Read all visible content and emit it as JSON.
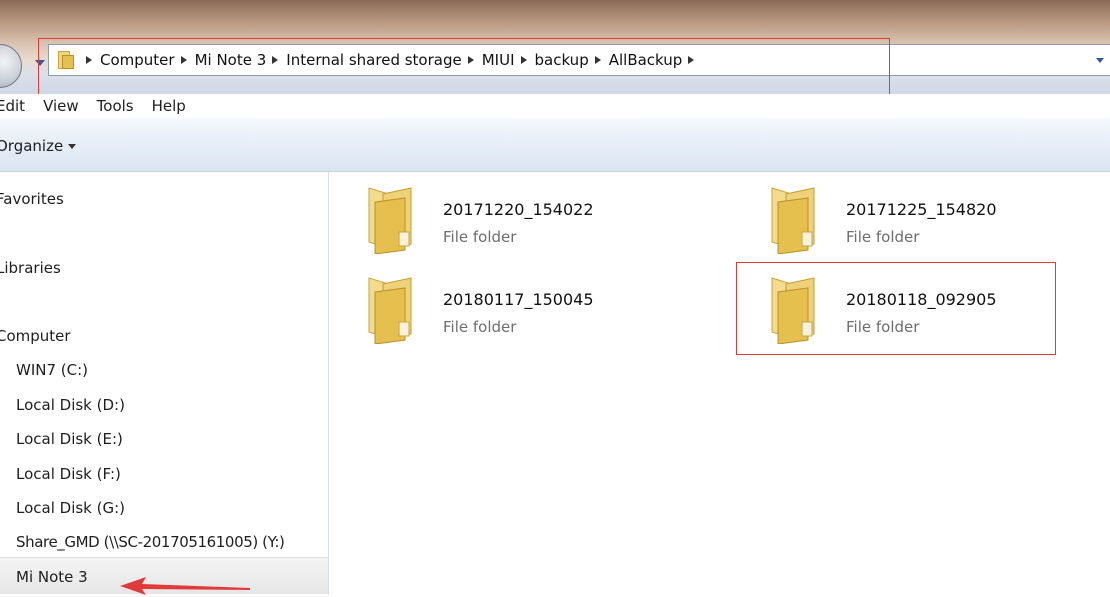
{
  "address_bar": {
    "breadcrumbs": [
      "Computer",
      "Mi Note 3",
      "Internal shared storage",
      "MIUI",
      "backup",
      "AllBackup"
    ]
  },
  "menu": {
    "items": [
      "Edit",
      "View",
      "Tools",
      "Help"
    ]
  },
  "toolbar": {
    "organize_label": "Organize"
  },
  "navigation": {
    "favorites": "Favorites",
    "libraries": "Libraries",
    "computer": "Computer",
    "drives": [
      "WIN7 (C:)",
      "Local Disk (D:)",
      "Local Disk (E:)",
      "Local Disk (F:)",
      "Local Disk (G:)",
      "Share_GMD (\\\\SC-201705161005) (Y:)",
      "Mi Note 3"
    ],
    "selected": "Mi Note 3"
  },
  "folders": [
    {
      "name": "20171220_154022",
      "type": "File folder"
    },
    {
      "name": "20171225_154820",
      "type": "File folder"
    },
    {
      "name": "20180117_150045",
      "type": "File folder"
    },
    {
      "name": "20180118_092905",
      "type": "File folder"
    }
  ],
  "colors": {
    "highlight": "#e03b3b",
    "folder": "#e6c04f",
    "nav_selected": "#e6e6e6"
  }
}
